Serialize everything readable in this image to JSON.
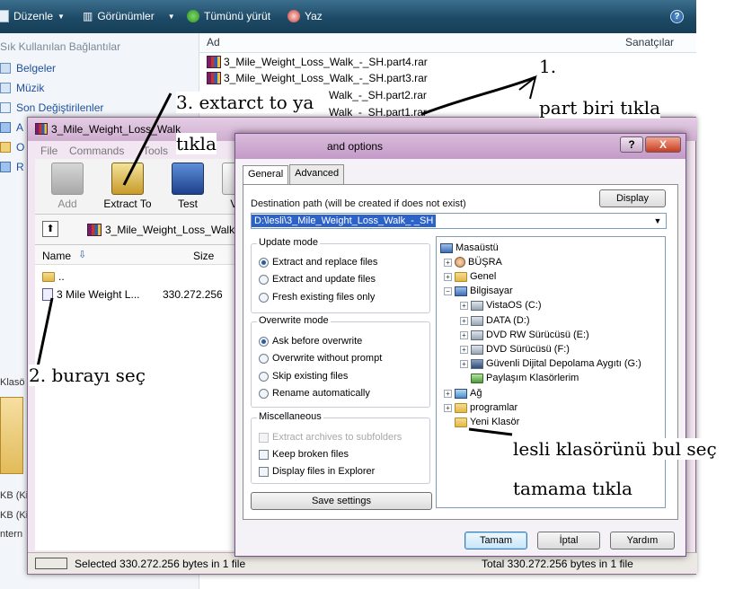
{
  "explorer": {
    "toolbar": {
      "organize": "Düzenle",
      "views": "Görünümler",
      "play_all": "Tümünü yürüt",
      "burn": "Yaz",
      "help": "?"
    },
    "nav": {
      "header": "Sık Kullanılan Bağlantılar",
      "items": [
        "Belgeler",
        "Müzik",
        "Son Değiştirilenler",
        "A",
        "O",
        "R"
      ],
      "lower_label": "Klasö",
      "bottom_frags": [
        "KB (Kil",
        "KB (Kil",
        "ntern"
      ]
    },
    "columns": {
      "name": "Ad",
      "artist": "Sanatçılar"
    },
    "files": [
      "3_Mile_Weight_Loss_Walk_-_SH.part4.rar",
      "3_Mile_Weight_Loss_Walk_-_SH.part3.rar",
      "Walk_-_SH.part2.rar",
      "Walk_-_SH.part1.rar"
    ]
  },
  "winrar": {
    "title": "3_Mile_Weight_Loss_Walk",
    "menu": [
      "File",
      "Commands",
      "Tools"
    ],
    "tools": {
      "add": "Add",
      "extract": "Extract To",
      "test": "Test",
      "view": "Vie"
    },
    "address": "3_Mile_Weight_Loss_Walk",
    "list_head": {
      "name": "Name",
      "size": "Size"
    },
    "rows": [
      {
        "name": "..",
        "size": ""
      },
      {
        "name": "3 Mile Weight L...",
        "size": "330.272.256"
      }
    ],
    "status_left": "Selected 330.272.256 bytes in 1 file",
    "status_right": "Total 330.272.256 bytes in 1 file"
  },
  "dialog": {
    "title": "and options",
    "title_help": "?",
    "title_close": "X",
    "tabs": [
      "General",
      "Advanced"
    ],
    "dest_label": "Destination path (will be created if does not exist)",
    "display_btn": "Display",
    "dest_value": "D:\\lesli\\3_Mile_Weight_Loss_Walk_-_SH",
    "update_mode": {
      "title": "Update mode",
      "options": [
        "Extract and replace files",
        "Extract and update files",
        "Fresh existing files only"
      ]
    },
    "overwrite_mode": {
      "title": "Overwrite mode",
      "options": [
        "Ask before overwrite",
        "Overwrite without prompt",
        "Skip existing files",
        "Rename automatically"
      ]
    },
    "misc": {
      "title": "Miscellaneous",
      "options": [
        "Extract archives to subfolders",
        "Keep broken files",
        "Display files in Explorer"
      ]
    },
    "save_btn": "Save settings",
    "tree": [
      "Masaüstü",
      "BÜŞRA",
      "Genel",
      "Bilgisayar",
      "VistaOS (C:)",
      "DATA (D:)",
      "DVD RW Sürücüsü (E:)",
      "DVD Sürücüsü (F:)",
      "Güvenli Dijital Depolama Aygıtı (G:)",
      "Paylaşım Klasörlerim",
      "Ağ",
      "programlar",
      "Yeni Klasör"
    ],
    "ok_btn": "Tamam",
    "cancel_btn": "İptal",
    "help_btn": "Yardım"
  },
  "annotations": {
    "n1": "1.",
    "n1b": "part biri tıkla",
    "n2": "2. burayı seç",
    "n3": "3. extarct to ya",
    "n3b": "tıkla",
    "n4": "lesli klasörünü bul seç",
    "n4b": "tamama tıkla"
  }
}
